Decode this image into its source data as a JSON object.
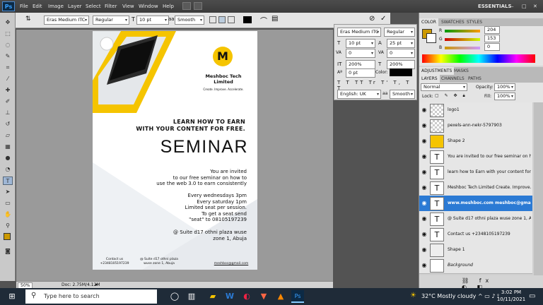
{
  "menubar": {
    "app_icon": "Ps",
    "items": [
      "File",
      "Edit",
      "Image",
      "Layer",
      "Select",
      "Filter",
      "View",
      "Window",
      "Help"
    ],
    "workspace": "ESSENTIALS"
  },
  "options": {
    "font_family": "Eras Medium ITC",
    "font_style": "Regular",
    "font_size": "10 pt",
    "antialias": "Smooth"
  },
  "character": {
    "font_family": "Eras Medium ITC",
    "font_style": "Regular",
    "size": "10 pt",
    "leading": "25 pt",
    "kerning": "0",
    "tracking": "0",
    "vscale": "200%",
    "hscale": "200%",
    "baseline": "0 pt",
    "color_label": "Color:",
    "language": "English: UK",
    "antialias": "Smooth"
  },
  "color_panel": {
    "tabs": [
      "COLOR",
      "SWATCHES",
      "STYLES"
    ],
    "r": "204",
    "g": "153",
    "b": "0",
    "r_label": "R",
    "g_label": "G",
    "b_label": "B",
    "fg_color": "#cc9900"
  },
  "adjust_tabs": [
    "ADJUSTMENTS",
    "MASKS"
  ],
  "layers_panel": {
    "tabs": [
      "LAYERS",
      "CHANNELS",
      "PATHS"
    ],
    "blend": "Normal",
    "opacity_label": "Opacity:",
    "opacity": "100%",
    "lock_label": "Lock:",
    "fill_label": "Fill:",
    "fill": "100%",
    "layers": [
      {
        "name": "logo1",
        "type": "image"
      },
      {
        "name": "pexels-ann-nekr-5797903",
        "type": "image"
      },
      {
        "name": "Shape 2",
        "type": "shape"
      },
      {
        "name": "You are invited  to our free seminar on how t...",
        "type": "text"
      },
      {
        "name": "learn how to Earn  with your content for fre...",
        "type": "text"
      },
      {
        "name": "Meshboc Tech Limited Create. Improve. Acc...",
        "type": "text"
      },
      {
        "name": "www.meshboc.com meshboc@gmail.com",
        "type": "text",
        "selected": true
      },
      {
        "name": "@ Suite d17 othni plaza  wuse zone 1, Abuja",
        "type": "text"
      },
      {
        "name": "Contact us +2348105197239",
        "type": "text"
      },
      {
        "name": "Shape 1",
        "type": "shape"
      },
      {
        "name": "Background",
        "type": "bg"
      }
    ]
  },
  "poster": {
    "logo_letter": "M",
    "company": "Meshboc Tech\nLimited",
    "tagline": "Create. Improve. Accelerate.",
    "headline1": "LEARN HOW TO EARN",
    "headline2": "WITH YOUR CONTENT FOR FREE.",
    "title": "SEMINAR",
    "body1": "You are invited",
    "body2": "to our free seminar on how to",
    "body3": "use the web 3.0 to earn consistently",
    "body4": "Every wednesdays 3pm",
    "body5": "Every saturday 1pm",
    "body6": "Limited seat per session.",
    "body7": "To get a seat send",
    "body8": "\"seat\" to 08105197239",
    "addr1": "@ Suite d17 othni plaza wuse",
    "addr2": "zone 1, Abuja",
    "footer_contact1": "Contact us",
    "footer_contact2": "+2348105197239",
    "footer_addr1": "@ Suite d17 othni plaza",
    "footer_addr2": "wuse zone 1, Abuja",
    "footer_email": "meshboc@gmail.com"
  },
  "status": {
    "zoom": "50%",
    "doc": "Doc: 2.75M/4.12M"
  },
  "taskbar": {
    "search_placeholder": "Type here to search",
    "temp": "32°C  Mostly cloudy",
    "time": "3:02 PM",
    "date": "10/11/2021"
  },
  "colors": {
    "accent": "#f5c400",
    "selected_layer": "#2b7ad4"
  }
}
